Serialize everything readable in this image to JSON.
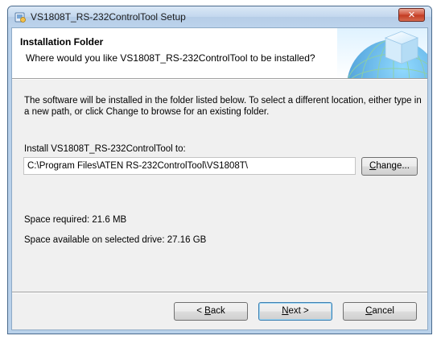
{
  "window": {
    "title": "VS1808T_RS-232ControlTool Setup",
    "close_glyph": "✕"
  },
  "header": {
    "title": "Installation Folder",
    "subtitle": "Where would you like VS1808T_RS-232ControlTool to be installed?",
    "graphic": "installer-globe-cube-graphic"
  },
  "body": {
    "description": "The software will be installed in the folder listed below. To select a different location, either type in a new path, or click Change to browse for an existing folder.",
    "install_label": "Install VS1808T_RS-232ControlTool to:",
    "install_path": "C:\\Program Files\\ATEN RS-232ControlTool\\VS1808T\\",
    "space_required": "Space required: 21.6 MB",
    "space_available": "Space available on selected drive: 27.16 GB"
  },
  "buttons": {
    "change": {
      "pre": "",
      "accel": "C",
      "post": "hange..."
    },
    "back": {
      "pre": "< ",
      "accel": "B",
      "post": "ack"
    },
    "next": {
      "pre": "",
      "accel": "N",
      "post": "ext >"
    },
    "cancel": {
      "pre": "",
      "accel": "C",
      "post": "ancel"
    }
  },
  "colors": {
    "accent_blue": "#3c7fb1",
    "close_red": "#c23a22",
    "dialog_bg": "#f0f0f0"
  },
  "icons": {
    "title": "setup-icon",
    "close": "close-icon"
  }
}
